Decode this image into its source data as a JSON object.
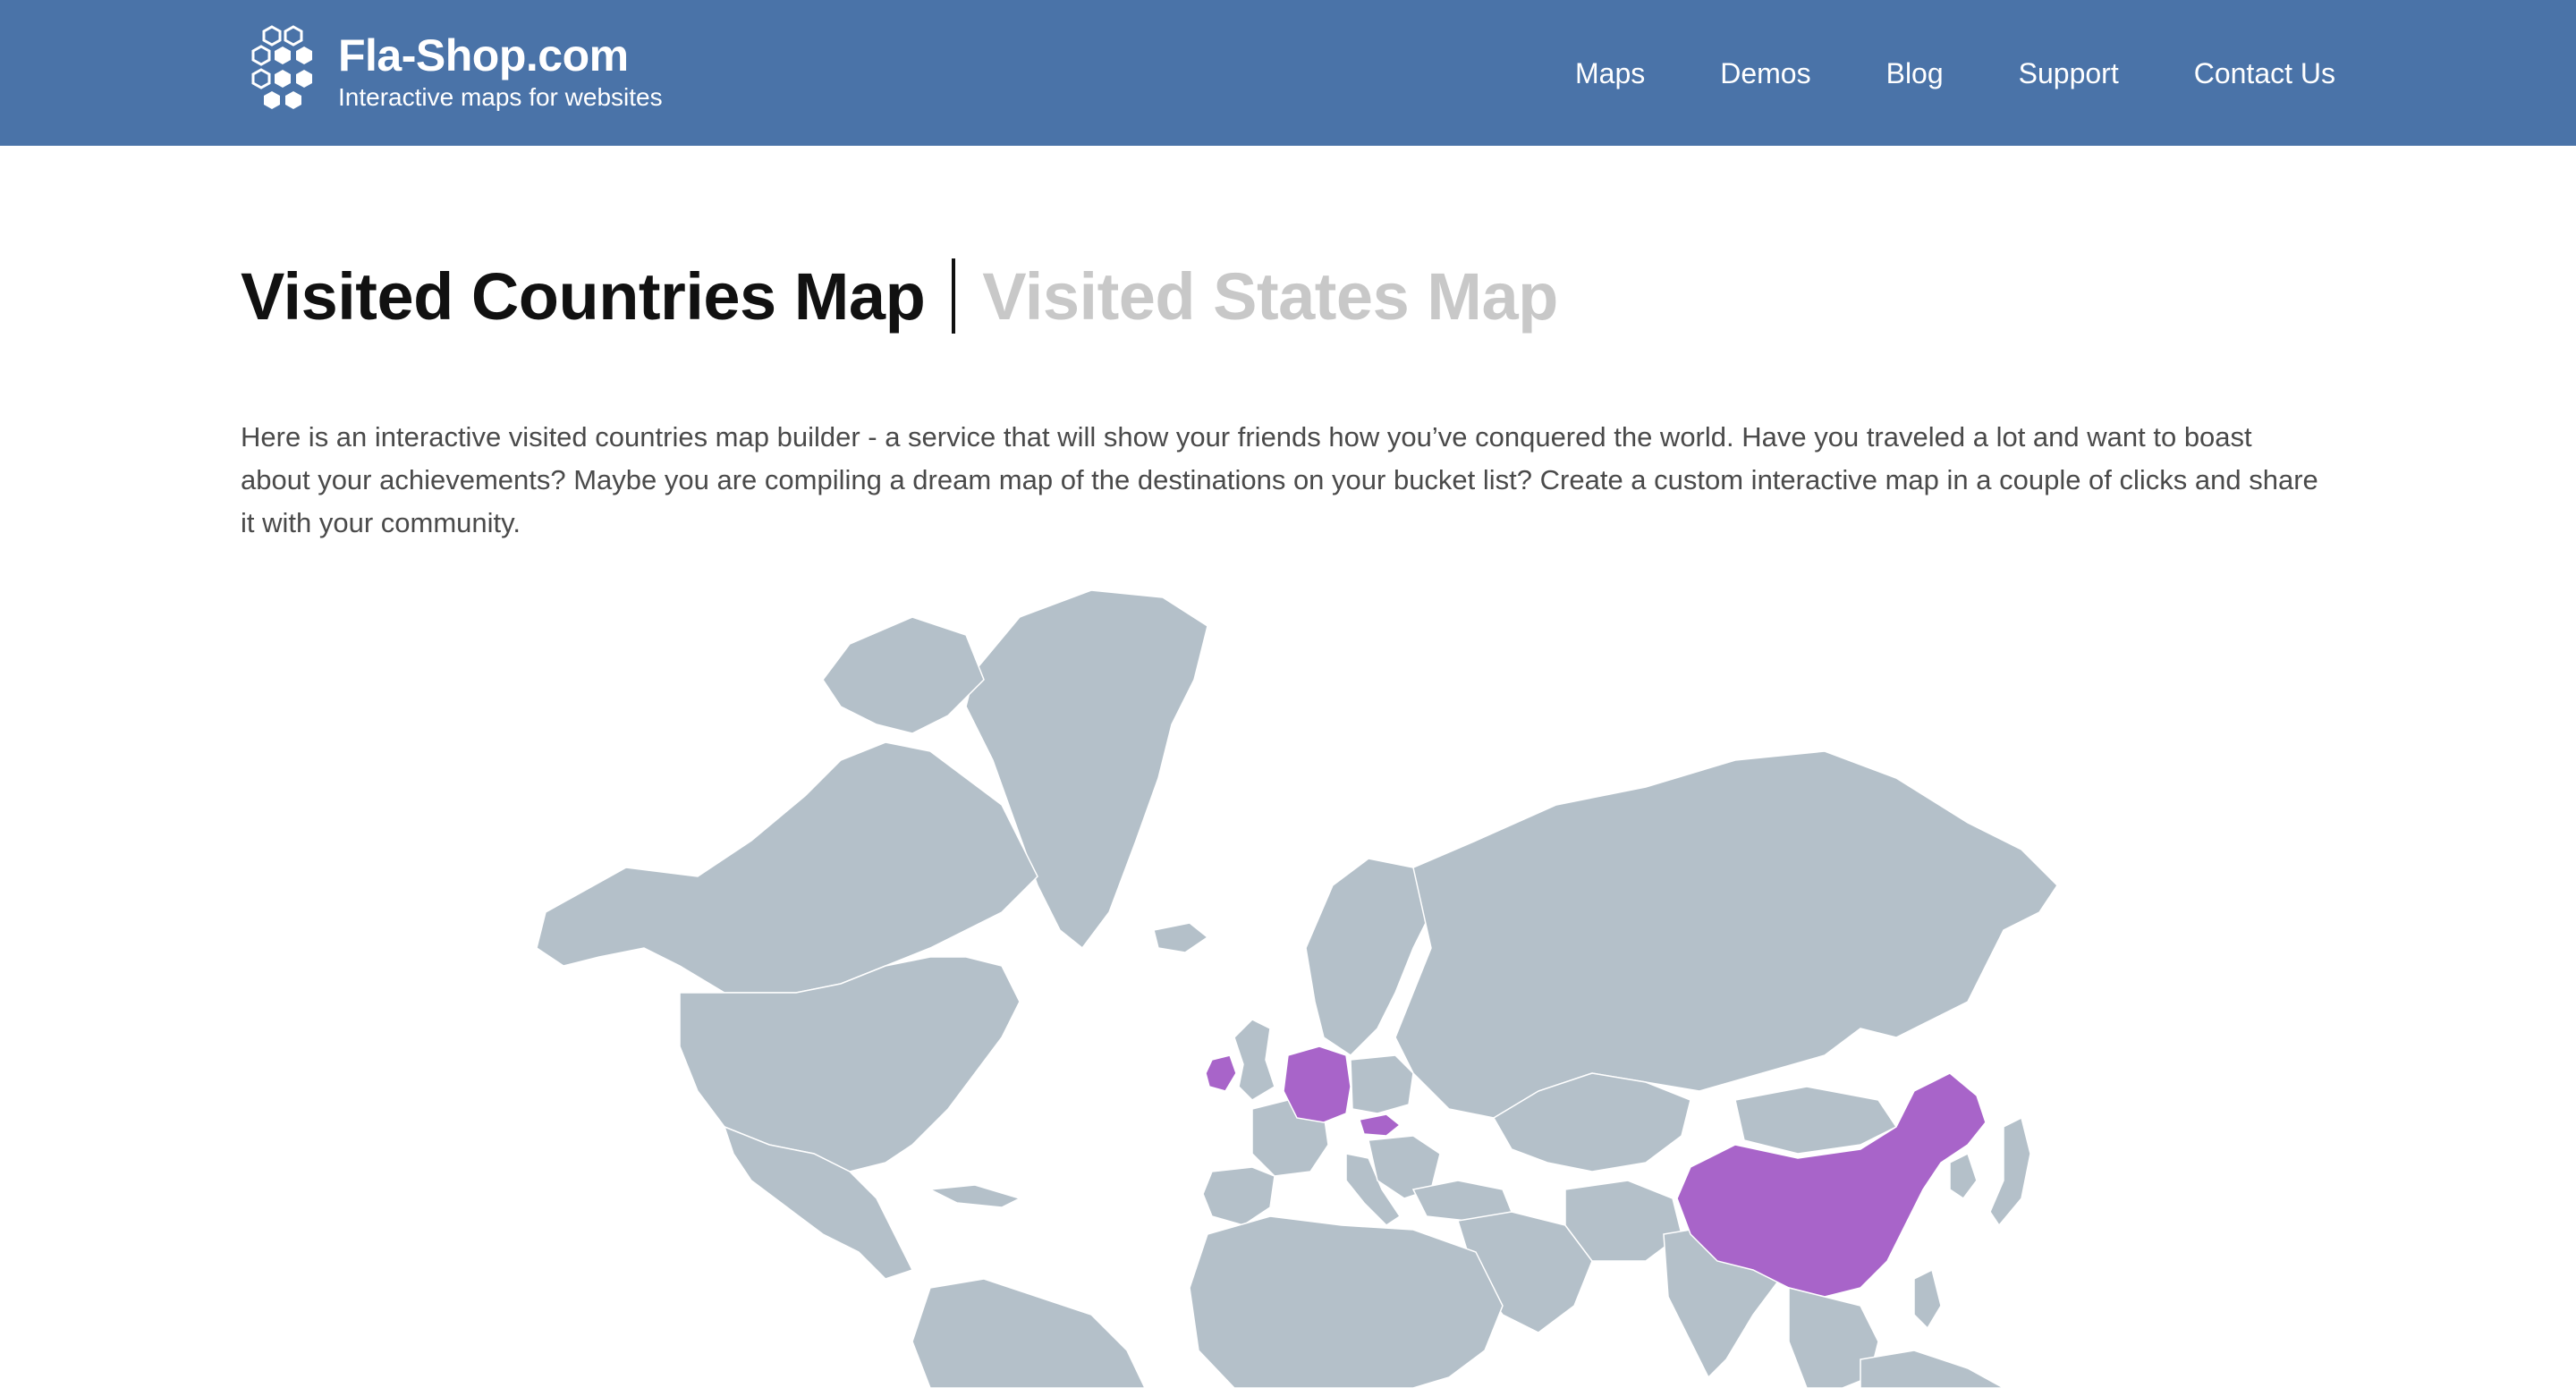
{
  "header": {
    "brand_title": "Fla-Shop.com",
    "brand_subtitle": "Interactive maps for websites",
    "nav": [
      "Maps",
      "Demos",
      "Blog",
      "Support",
      "Contact Us"
    ],
    "bg_color": "#4a73a8"
  },
  "main": {
    "title_active": "Visited Countries Map",
    "title_inactive": "Visited States Map",
    "intro": "Here is an interactive visited countries map builder - a service that will show your friends how you’ve conquered the world. Have you traveled a lot and want to boast about your achievements? Maybe you are compiling a dream map of the destinations on your bucket list? Create a custom interactive map in a couple of clicks and share it with your community."
  },
  "map": {
    "land_color": "#b4c0c9",
    "visited_color": "#a864c9",
    "visited_countries": [
      "Ireland",
      "Germany",
      "Hungary",
      "China"
    ]
  }
}
